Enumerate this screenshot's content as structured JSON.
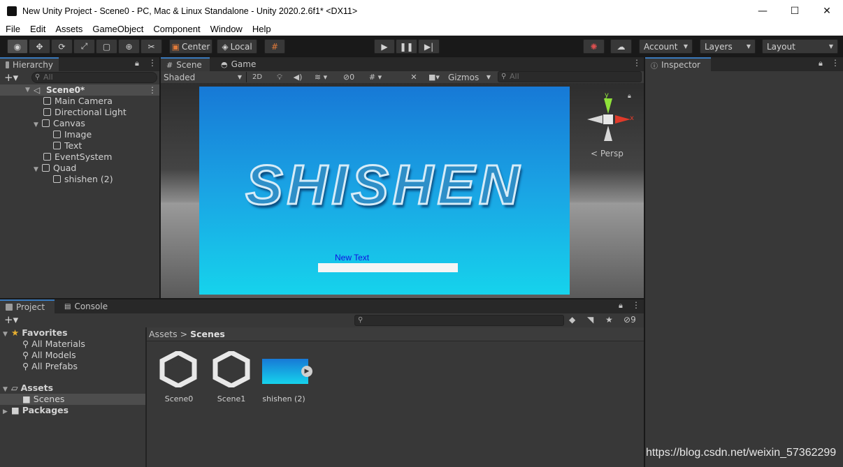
{
  "window": {
    "title": "New Unity Project - Scene0 - PC, Mac & Linux Standalone - Unity 2020.2.6f1* <DX11>",
    "minimize": "—",
    "maximize": "☐",
    "close": "✕"
  },
  "menu": [
    "File",
    "Edit",
    "Assets",
    "GameObject",
    "Component",
    "Window",
    "Help"
  ],
  "toolbar": {
    "center_label": "Center",
    "local_label": "Local",
    "account_label": "Account",
    "layers_label": "Layers",
    "layout_label": "Layout"
  },
  "hierarchy": {
    "tab": "Hierarchy",
    "search_placeholder": "All",
    "scene": "Scene0*",
    "items": [
      {
        "label": "Main Camera"
      },
      {
        "label": "Directional Light"
      },
      {
        "label": "Canvas"
      },
      {
        "label": "Image"
      },
      {
        "label": "Text"
      },
      {
        "label": "EventSystem"
      },
      {
        "label": "Quad"
      },
      {
        "label": "shishen (2)"
      }
    ]
  },
  "scene": {
    "tab_scene": "Scene",
    "tab_game": "Game",
    "shading": "Shaded",
    "mode_2d": "2D",
    "hidden_count": "0",
    "gizmos": "Gizmos",
    "search_placeholder": "All",
    "persp": "< Persp",
    "axis_y": "y",
    "axis_x": "x",
    "quad_text": "SHISHEN",
    "ui_text": "New Text"
  },
  "inspector": {
    "tab": "Inspector"
  },
  "project": {
    "tab_project": "Project",
    "tab_console": "Console",
    "hidden_count": "9",
    "favorites_label": "Favorites",
    "favorites": [
      "All Materials",
      "All Models",
      "All Prefabs"
    ],
    "assets_label": "Assets",
    "scenes_label": "Scenes",
    "packages_label": "Packages",
    "breadcrumb_root": "Assets",
    "breadcrumb_sep": ">",
    "breadcrumb_current": "Scenes",
    "files": [
      "Scene0",
      "Scene1",
      "shishen (2)"
    ]
  },
  "watermark": "https://blog.csdn.net/weixin_57362299",
  "colors": {
    "accent": "#3a79bb",
    "panel": "#383838",
    "dark": "#191919"
  }
}
